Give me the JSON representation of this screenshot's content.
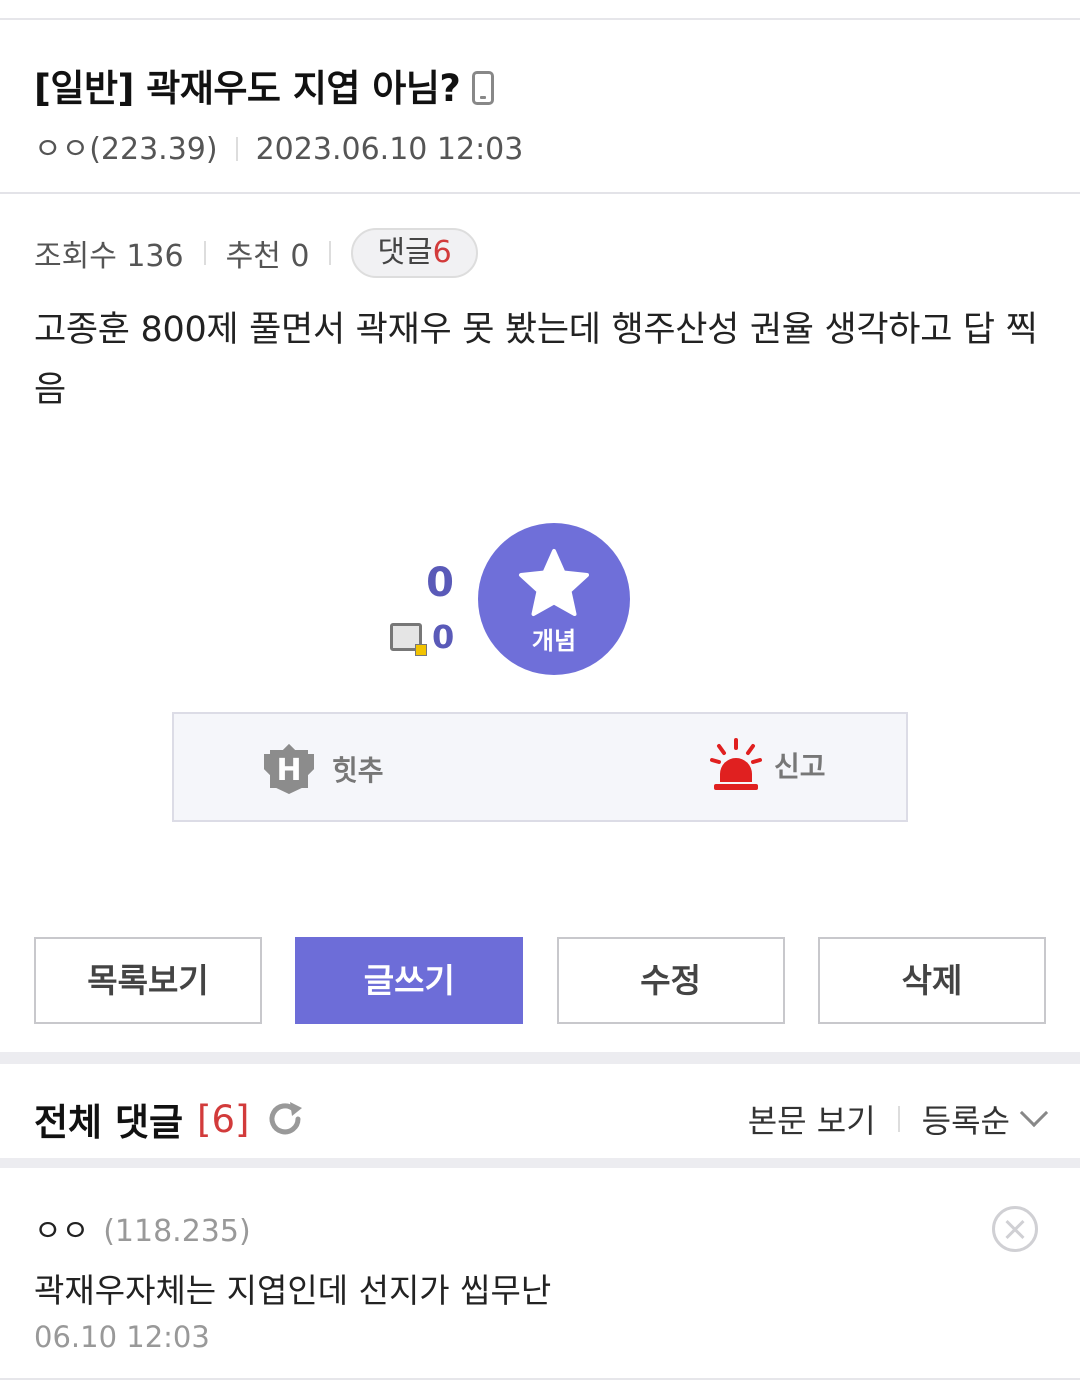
{
  "post": {
    "title": "[일반] 곽재우도 지엽 아님?",
    "author": "ㅇㅇ(223.39)",
    "datetime": "2023.06.10 12:03",
    "views_label": "조회수 136",
    "recommend_label": "추천 0",
    "comment_label": "댓글",
    "comment_count": "6",
    "body": "고종훈 800제 풀면서 곽재우 못 봤는데 행주산성 권율 생각하고 답 찍음"
  },
  "vote": {
    "count": "0",
    "fix_count": "0",
    "button_label": "개념"
  },
  "actions": {
    "hit_label": "힛추",
    "report_label": "신고"
  },
  "buttons": {
    "list": "목록보기",
    "write": "글쓰기",
    "edit": "수정",
    "delete": "삭제"
  },
  "comments": {
    "title": "전체 댓글",
    "count": "[6]",
    "view_body": "본문 보기",
    "sort": "등록순",
    "items": [
      {
        "user": "ㅇㅇ",
        "ip": "(118.235)",
        "text": "곽재우자체는 지엽인데 선지가 씹무난",
        "date": "06.10 12:03"
      }
    ]
  },
  "colors": {
    "accent": "#6d6dd8",
    "count_red": "#d23b3b",
    "report_red": "#e02020"
  }
}
